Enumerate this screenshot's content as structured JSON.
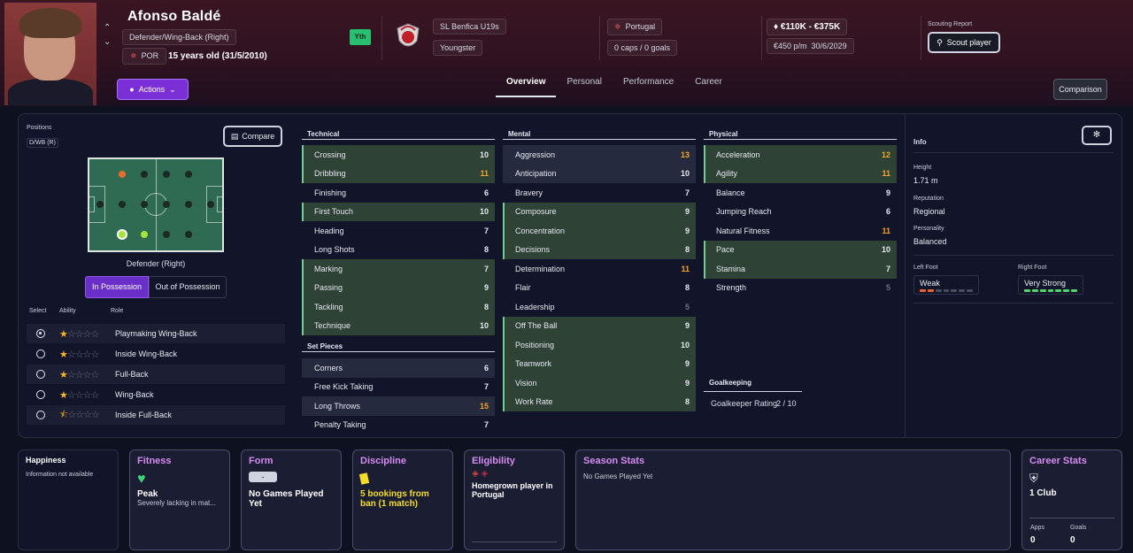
{
  "player": {
    "name": "Afonso Baldé",
    "position": "Defender/Wing-Back (Right)",
    "nation_code": "POR",
    "age": "15 years old (31/5/2010)",
    "yth": "Yth"
  },
  "club": {
    "name": "SL Benfica U19s",
    "status": "Youngster"
  },
  "nation": {
    "name": "Portugal",
    "caps": "0 caps / 0 goals"
  },
  "contract": {
    "value": "€110K - €375K",
    "wage": "€450 p/m",
    "expiry": "30/6/2029"
  },
  "scouting": {
    "label": "Scouting Report",
    "button": "Scout player"
  },
  "actions_label": "Actions",
  "tabs": [
    "Overview",
    "Personal",
    "Performance",
    "Career"
  ],
  "comparison_label": "Comparison",
  "positions": {
    "label": "Positions",
    "code": "D/WB (R)",
    "compare": "Compare",
    "selected_position": "Defender (Right)",
    "in_possession": "In Possession",
    "out_possession": "Out of Possession",
    "headers": {
      "select": "Select",
      "ability": "Ability",
      "role": "Role"
    }
  },
  "roles": [
    {
      "name": "Playmaking Wing-Back",
      "stars": 1,
      "selected": true
    },
    {
      "name": "Inside Wing-Back",
      "stars": 1,
      "selected": false
    },
    {
      "name": "Full-Back",
      "stars": 1,
      "selected": false
    },
    {
      "name": "Wing-Back",
      "stars": 1,
      "selected": false
    },
    {
      "name": "Inside Full-Back",
      "stars": 0.5,
      "selected": false
    }
  ],
  "technical": {
    "title": "Technical",
    "items": [
      {
        "n": "Crossing",
        "v": "10"
      },
      {
        "n": "Dribbling",
        "v": "11"
      },
      {
        "n": "Finishing",
        "v": "6"
      },
      {
        "n": "First Touch",
        "v": "10"
      },
      {
        "n": "Heading",
        "v": "7"
      },
      {
        "n": "Long Shots",
        "v": "8"
      },
      {
        "n": "Marking",
        "v": "7"
      },
      {
        "n": "Passing",
        "v": "9"
      },
      {
        "n": "Tackling",
        "v": "8"
      },
      {
        "n": "Technique",
        "v": "10"
      }
    ]
  },
  "setpieces": {
    "title": "Set Pieces",
    "items": [
      {
        "n": "Corners",
        "v": "6"
      },
      {
        "n": "Free Kick Taking",
        "v": "7"
      },
      {
        "n": "Long Throws",
        "v": "15"
      },
      {
        "n": "Penalty Taking",
        "v": "7"
      }
    ]
  },
  "mental": {
    "title": "Mental",
    "items": [
      {
        "n": "Aggression",
        "v": "13"
      },
      {
        "n": "Anticipation",
        "v": "10"
      },
      {
        "n": "Bravery",
        "v": "7"
      },
      {
        "n": "Composure",
        "v": "9"
      },
      {
        "n": "Concentration",
        "v": "9"
      },
      {
        "n": "Decisions",
        "v": "8"
      },
      {
        "n": "Determination",
        "v": "11"
      },
      {
        "n": "Flair",
        "v": "8"
      },
      {
        "n": "Leadership",
        "v": "5"
      },
      {
        "n": "Off The Ball",
        "v": "9"
      },
      {
        "n": "Positioning",
        "v": "10"
      },
      {
        "n": "Teamwork",
        "v": "9"
      },
      {
        "n": "Vision",
        "v": "9"
      },
      {
        "n": "Work Rate",
        "v": "8"
      }
    ]
  },
  "physical": {
    "title": "Physical",
    "items": [
      {
        "n": "Acceleration",
        "v": "12"
      },
      {
        "n": "Agility",
        "v": "11"
      },
      {
        "n": "Balance",
        "v": "9"
      },
      {
        "n": "Jumping Reach",
        "v": "6"
      },
      {
        "n": "Natural Fitness",
        "v": "11"
      },
      {
        "n": "Pace",
        "v": "10"
      },
      {
        "n": "Stamina",
        "v": "7"
      },
      {
        "n": "Strength",
        "v": "5"
      }
    ]
  },
  "goalkeeping": {
    "title": "Goalkeeping",
    "label": "Goalkeeper Rating",
    "value": "2 / 10"
  },
  "info": {
    "title": "Info",
    "height_label": "Height",
    "height": "1.71 m",
    "reputation_label": "Reputation",
    "reputation": "Regional",
    "personality_label": "Personality",
    "personality": "Balanced",
    "left_foot_label": "Left Foot",
    "left_foot": "Weak",
    "left_foot_level": 2,
    "right_foot_label": "Right Foot",
    "right_foot": "Very Strong",
    "right_foot_level": 7
  },
  "cards": {
    "happiness": {
      "title": "Happiness",
      "text": "Information not available"
    },
    "fitness": {
      "title": "Fitness",
      "status": "Peak",
      "sub": "Severely lacking in mat..."
    },
    "form": {
      "title": "Form",
      "pill": "-",
      "text": "No Games Played Yet"
    },
    "discipline": {
      "title": "Discipline",
      "text": "5 bookings from ban (1 match)"
    },
    "eligibility": {
      "title": "Eligibility",
      "text": "Homegrown player in Portugal"
    },
    "season": {
      "title": "Season Stats",
      "text": "No Games Played Yet"
    },
    "career": {
      "title": "Career Stats",
      "clubs": "1 Club",
      "apps_label": "Apps",
      "apps": "0",
      "goals_label": "Goals",
      "goals": "0"
    }
  }
}
